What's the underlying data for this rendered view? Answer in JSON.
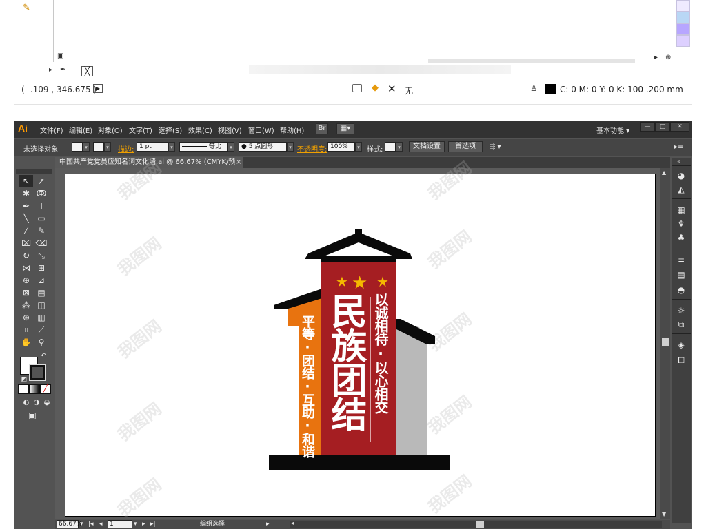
{
  "prev_window": {
    "coordinates": "( -.109 , 346.675 )",
    "none_label": "无",
    "color_readout": "C: 0 M: 0 Y: 0 K: 100",
    "stroke_width_readout": ".200 mm",
    "swatch_colors": [
      "#e9e3ff",
      "#b9d7f5",
      "#b7a6ff",
      "#ddd0ff"
    ]
  },
  "app": {
    "logo": "Ai",
    "menus": [
      "文件(F)",
      "编辑(E)",
      "对象(O)",
      "文字(T)",
      "选择(S)",
      "效果(C)",
      "视图(V)",
      "窗口(W)",
      "帮助(H)"
    ],
    "bridge_label": "Br",
    "workspace": "基本功能",
    "window_controls": [
      "—",
      "▢",
      "✕"
    ]
  },
  "control_bar": {
    "selection_label": "未选择对象",
    "stroke_label": "描边:",
    "stroke_weight": "1 pt",
    "stroke_profile": "等比",
    "brush": "5 点圆形",
    "opacity_label": "不透明度:",
    "opacity_value": "100%",
    "style_label": "样式:",
    "doc_setup_button": "文档设置",
    "prefs_button": "首选项"
  },
  "document_tab": {
    "title": "中国共产党党员应知名词文化墙.ai @ 66.67% (CMYK/预览)",
    "close": "×"
  },
  "artwork": {
    "main_title": "民族团结",
    "left_slogan": "平等·团结·互助·和谐",
    "right_slogan": "以诚相待·以心相交",
    "stars": 3,
    "colors": {
      "red": "#a51e22",
      "orange": "#e8730f",
      "gray": "#b9b9b9",
      "black": "#0a0a0a",
      "star": "#f5b800"
    }
  },
  "status_bar": {
    "zoom": "66.67%",
    "page": "1",
    "mode": "编组选择"
  },
  "watermark_text": "我图网"
}
